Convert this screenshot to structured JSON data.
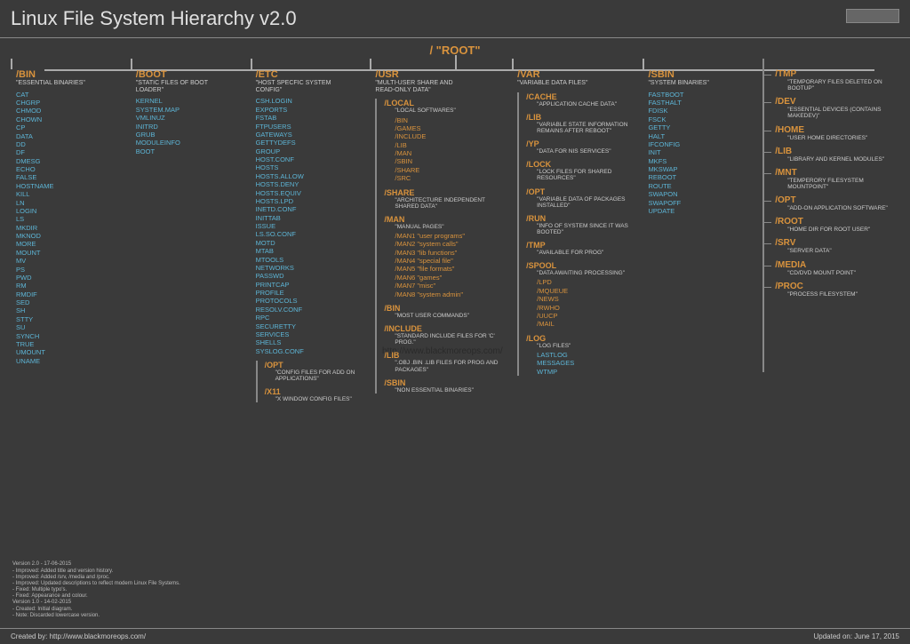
{
  "title": "Linux File System Hierarchy v2.0",
  "root": "/ \"ROOT\"",
  "watermark": "http://www.blackmoreops.com/",
  "bin": {
    "title": "/BIN",
    "desc": "\"ESSENTIAL BINARIES\"",
    "items": [
      "CAT",
      "CHGRP",
      "CHMOD",
      "CHOWN",
      "CP",
      "DATA",
      "DD",
      "DF",
      "DMESG",
      "ECHO",
      "FALSE",
      "HOSTNAME",
      "KILL",
      "LN",
      "LOGIN",
      "LS",
      "MKDIR",
      "MKNOD",
      "MORE",
      "MOUNT",
      "MV",
      "PS",
      "PWD",
      "RM",
      "RMDIF",
      "SED",
      "SH",
      "STTY",
      "SU",
      "SYNCH",
      "TRUE",
      "UMOUNT",
      "UNAME"
    ]
  },
  "boot": {
    "title": "/BOOT",
    "desc": "\"STATIC FILES OF BOOT LOADER\"",
    "items": [
      "KERNEL",
      "SYSTEM.MAP",
      "VMLINUZ",
      "INITRD",
      "GRUB",
      "MODULEINFO",
      "BOOT"
    ]
  },
  "etc": {
    "title": "/ETC",
    "desc": "\"HOST SPECFIC SYSTEM CONFIG\"",
    "items": [
      "CSH.LOGIN",
      "EXPORTS",
      "FSTAB",
      "FTPUSERS",
      "GATEWAYS",
      "GETTYDEFS",
      "GROUP",
      "HOST.CONF",
      "HOSTS",
      "HOSTS.ALLOW",
      "HOSTS.DENY",
      "HOSTS.EQUIV",
      "HOSTS.LPD",
      "INETD.CONF",
      "INITTAB",
      "ISSUE",
      "LS.SO.CONF",
      "MOTD",
      "MTAB",
      "MTOOLS",
      "NETWORKS",
      "PASSWD",
      "PRINTCAP",
      "PROFILE",
      "PROTOCOLS",
      "RESOLV.CONF",
      "RPC",
      "SECURETTY",
      "SERVICES",
      "SHELLS",
      "SYSLOG.CONF"
    ],
    "subs": [
      {
        "title": "/OPT",
        "desc": "\"CONFIG FILES FOR ADD ON APPLICATIONS\""
      },
      {
        "title": "/X11",
        "desc": "\"X WINDOW CONFIG FILES\""
      }
    ]
  },
  "usr": {
    "title": "/USR",
    "desc": "\"MULTI-USER SHARE AND READ-ONLY DATA\"",
    "subs": [
      {
        "title": "/LOCAL",
        "desc": "\"LOCAL SOFTWARES\"",
        "items": [
          "/BIN",
          "/GAMES",
          "/INCLUDE",
          "/LIB",
          "/MAN",
          "/SBIN",
          "/SHARE",
          "/SRC"
        ]
      },
      {
        "title": "/SHARE",
        "desc": "\"ARCHITECTURE INDEPENDENT SHARED DATA\""
      },
      {
        "title": "/MAN",
        "desc": "\"MANUAL PAGES\"",
        "items": [
          "/MAN1 \"user programs\"",
          "/MAN2 \"system calls\"",
          "/MAN3 \"lib functions\"",
          "/MAN4 \"special file\"",
          "/MAN5 \"file formats\"",
          "/MAN6 \"games\"",
          "/MAN7 \"misc\"",
          "/MAN8 \"system admin\""
        ]
      },
      {
        "title": "/BIN",
        "desc": "\"MOST USER COMMANDS\""
      },
      {
        "title": "/INCLUDE",
        "desc": "\"STANDARD INCLUDE FILES FOR 'C' PROG.\""
      },
      {
        "title": "/LIB",
        "desc": "\".OBJ .BIN .LIB FILES FOR PROG AND PACKAGES\""
      },
      {
        "title": "/SBIN",
        "desc": "\"NON ESSENTIAL BINARIES\""
      }
    ]
  },
  "var": {
    "title": "/VAR",
    "desc": "\"VARIABLE DATA FILES\"",
    "subs": [
      {
        "title": "/CACHE",
        "desc": "\"APPLICATION CACHE DATA\""
      },
      {
        "title": "/LIB",
        "desc": "\"VARIABLE STATE INFORMATION REMAINS AFTER REBOOT\""
      },
      {
        "title": "/YP",
        "desc": "\"DATA FOR NIS SERVICES\""
      },
      {
        "title": "/LOCK",
        "desc": "\"LOCK FILES FOR SHARED RESOURCES\""
      },
      {
        "title": "/OPT",
        "desc": "\"VARIABLE DATA OF PACKAGES INSTALLED\""
      },
      {
        "title": "/RUN",
        "desc": "\"INFO OF SYSTEM SINCE IT WAS BOOTED\""
      },
      {
        "title": "/TMP",
        "desc": "\"AVAILABLE FOR PROG\""
      },
      {
        "title": "/SPOOL",
        "desc": "\"DATA AWAITING PROCESSING\"",
        "items": [
          "/LPD",
          "/MQUEUE",
          "/NEWS",
          "/RWHO",
          "/UUCP",
          "/MAIL"
        ]
      },
      {
        "title": "/LOG",
        "desc": "\"LOG FILES\"",
        "items": [
          "LASTLOG",
          "MESSAGES",
          "WTMP"
        ],
        "cyan": true
      }
    ]
  },
  "sbin": {
    "title": "/SBIN",
    "desc": "\"SYSTEM BINARIES\"",
    "items": [
      "FASTBOOT",
      "FASTHALT",
      "FDISK",
      "FSCK",
      "GETTY",
      "HALT",
      "IFCONFIG",
      "INIT",
      "MKFS",
      "MKSWAP",
      "REBOOT",
      "ROUTE",
      "SWAPON",
      "SWAPOFF",
      "UPDATE"
    ]
  },
  "right": [
    {
      "title": "/TMP",
      "desc": "\"TEMPORARY FILES DELETED ON BOOTUP\""
    },
    {
      "title": "/DEV",
      "desc": "\"ESSENTIAL DEVICES (CONTAINS MAKEDEV)\""
    },
    {
      "title": "/HOME",
      "desc": "\"USER HOME DIRECTORIES\""
    },
    {
      "title": "/LIB",
      "desc": "\"LIBRARY AND KERNEL MODULES\""
    },
    {
      "title": "/MNT",
      "desc": "\"TEMPERORY FILESYSTEM MOUNTPOINT\""
    },
    {
      "title": "/OPT",
      "desc": "\"ADD-ON APPLICATION SOFTWARE\""
    },
    {
      "title": "/ROOT",
      "desc": "\"HOME DIR FOR ROOT USER\""
    },
    {
      "title": "/SRV",
      "desc": "\"SERVER DATA\""
    },
    {
      "title": "/MEDIA",
      "desc": "\"CD/DVD MOUNT POINT\""
    },
    {
      "title": "/PROC",
      "desc": "\"PROCESS FILESYSTEM\""
    }
  ],
  "version_lines": [
    "Version 2.0 - 17-06-2015",
    "- Improved: Added title and version history.",
    "- Improved: Added /srv, /media and /proc.",
    "- Improved: Updated descriptions to reflect modern Linux File Systems.",
    "- Fixed: Multiple typo's.",
    "- Fixed: Appearance and colour.",
    "Version 1.0 - 14-02-2015",
    "- Created: Initial diagram.",
    "- Note: Discarded lowercase version."
  ],
  "footer_left": "Created by: http://www.blackmoreops.com/",
  "footer_right": "Updated on: June 17, 2015"
}
